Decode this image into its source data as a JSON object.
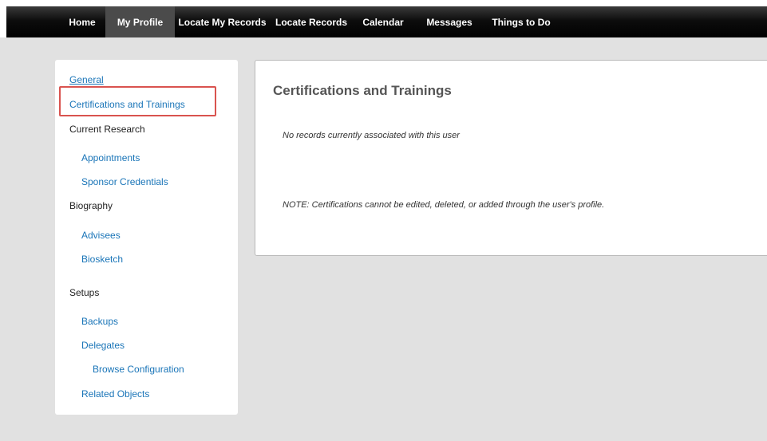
{
  "nav": {
    "items": [
      "Home",
      "My Profile",
      "Locate My Records",
      "Locate Records",
      "Calendar",
      "Messages",
      "Things to Do"
    ],
    "active": "My Profile"
  },
  "sidebar": {
    "items": [
      {
        "label": "General",
        "type": "link"
      },
      {
        "label": "Certifications and Trainings",
        "type": "link",
        "highlighted": true
      },
      {
        "label": "Current Research",
        "type": "heading"
      },
      {
        "label": "Appointments",
        "type": "link"
      },
      {
        "label": "Sponsor Credentials",
        "type": "link"
      },
      {
        "label": "Biography",
        "type": "heading"
      },
      {
        "label": "Advisees",
        "type": "link"
      },
      {
        "label": "Biosketch",
        "type": "link"
      },
      {
        "label": "Setups",
        "type": "heading"
      },
      {
        "label": "Backups",
        "type": "link"
      },
      {
        "label": "Delegates",
        "type": "link"
      },
      {
        "label": "Browse Configuration",
        "type": "link"
      },
      {
        "label": "Related Objects",
        "type": "link"
      }
    ]
  },
  "panel": {
    "title": "Certifications and Trainings",
    "empty_message": "No records currently associated with this user",
    "note": "NOTE: Certifications cannot be edited, deleted, or added through the user's profile."
  },
  "colors": {
    "link": "#1a75b8",
    "highlight_border": "#d9534f",
    "nav_bg": "#000000",
    "page_bg": "#e1e1e1"
  }
}
